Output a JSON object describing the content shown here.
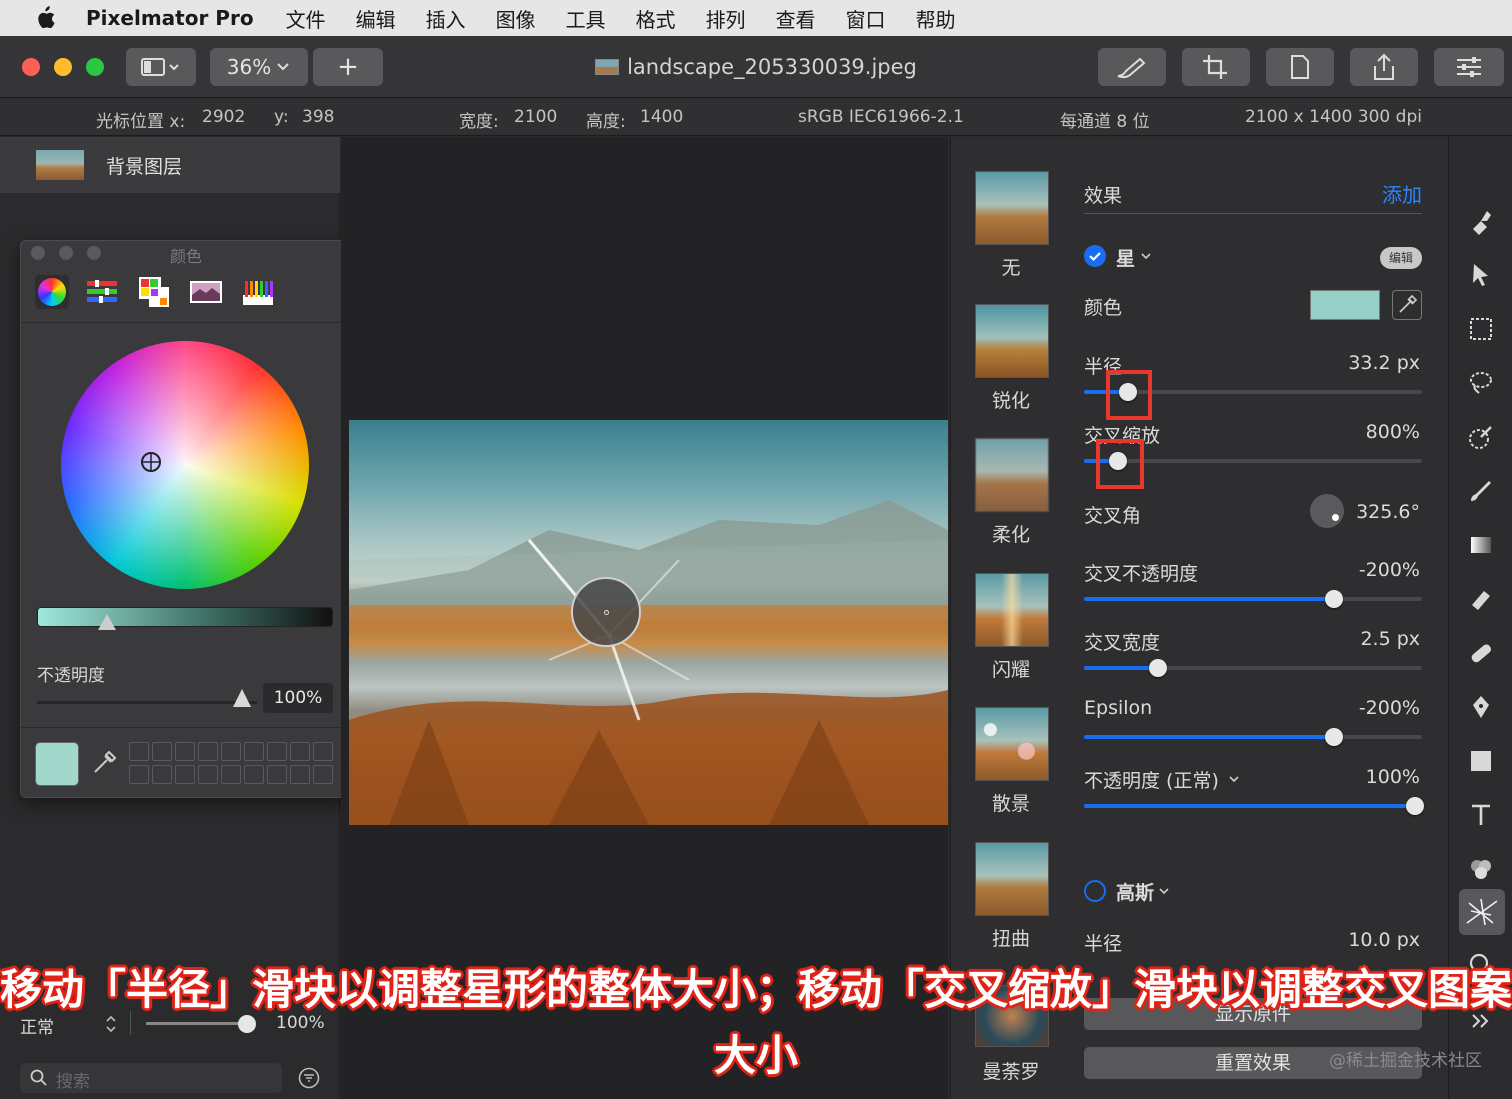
{
  "menubar": {
    "app": "Pixelmator Pro",
    "items": [
      "文件",
      "编辑",
      "插入",
      "图像",
      "工具",
      "格式",
      "排列",
      "查看",
      "窗口",
      "帮助"
    ]
  },
  "toolbar": {
    "zoom": "36%",
    "add": "+",
    "doc_title": "landscape_205330039.jpeg"
  },
  "infobar": {
    "cursor_x_label": "光标位置 x:",
    "cursor_x": "2902",
    "cursor_y_label": "y:",
    "cursor_y": "398",
    "width_label": "宽度:",
    "width": "2100",
    "height_label": "高度:",
    "height": "1400",
    "color_profile": "sRGB IEC61966-2.1",
    "bit_depth": "每通道 8 位",
    "dimensions": "2100 x 1400 300 dpi"
  },
  "layers": {
    "layer_name": "背景图层",
    "blend_mode": "正常",
    "opacity": "100%",
    "search_placeholder": "搜索"
  },
  "color_window": {
    "title": "颜色",
    "opacity_label": "不透明度",
    "opacity_value": "100%",
    "current_color": "#a2d7cc"
  },
  "effects": {
    "header": "效果",
    "add": "添加",
    "thumbnails": [
      "无",
      "锐化",
      "柔化",
      "闪耀",
      "散景",
      "扭曲",
      "曼荼罗"
    ],
    "star": {
      "name": "星",
      "edit": "编辑",
      "color_label": "颜色",
      "color": "#96cfc8",
      "params": [
        {
          "label": "半径",
          "value": "33.2 px",
          "level": 0.13
        },
        {
          "label": "交叉缩放",
          "value": "800%",
          "level": 0.1
        },
        {
          "label": "交叉角",
          "value": "325.6°"
        },
        {
          "label": "交叉不透明度",
          "value": "-200%",
          "level": 0.74
        },
        {
          "label": "交叉宽度",
          "value": "2.5 px",
          "level": 0.22
        },
        {
          "label": "Epsilon",
          "value": "-200%",
          "level": 0.74
        },
        {
          "label": "不透明度 (正常)",
          "value": "100%",
          "level": 0.98
        }
      ]
    },
    "gaussian": {
      "name": "高斯",
      "radius_label": "半径",
      "radius_value": "10.0 px"
    },
    "show_original": "显示原件",
    "reset": "重置效果"
  },
  "caption": {
    "line1": "移动「半径」滑块以调整星形的整体大小；移动「交叉缩放」滑块以调整交叉图案的",
    "line2": "大小"
  },
  "watermark": "@稀土掘金技术社区",
  "colors": {
    "accent": "#1a6cf0",
    "highlight": "#e8382e"
  }
}
